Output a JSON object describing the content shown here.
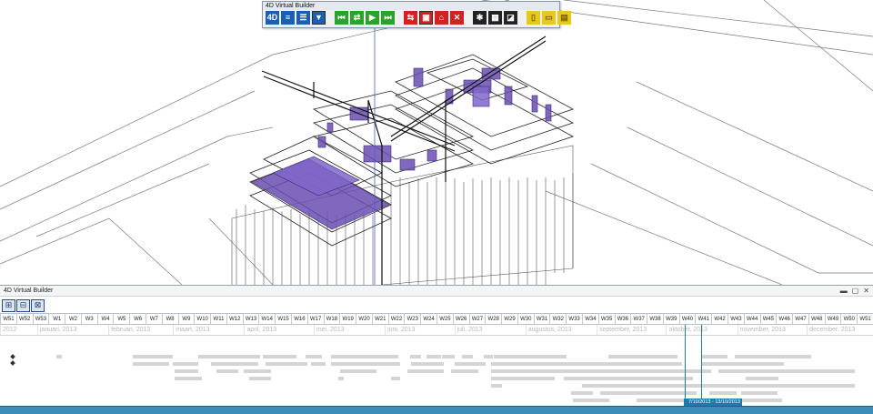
{
  "floating_toolbar": {
    "title": "4D Virtual Builder",
    "buttons": [
      {
        "name": "4d-mode-icon",
        "glyph": "4D",
        "color": "#1a5fb4"
      },
      {
        "name": "gantt-view-icon",
        "glyph": "≡",
        "color": "#1a5fb4"
      },
      {
        "name": "list-view-icon",
        "glyph": "☰",
        "color": "#1a5fb4"
      },
      {
        "name": "filter-icon",
        "glyph": "▼",
        "color": "#1a5fb4"
      },
      {
        "name": "skip-to-start-icon",
        "glyph": "⏮",
        "color": "#29a329"
      },
      {
        "name": "loop-icon",
        "glyph": "⇄",
        "color": "#29a329"
      },
      {
        "name": "play-icon",
        "glyph": "▶",
        "color": "#29a329"
      },
      {
        "name": "skip-to-end-icon",
        "glyph": "⏭",
        "color": "#29a329"
      },
      {
        "name": "task-link-icon",
        "glyph": "⇆",
        "color": "#d42020"
      },
      {
        "name": "select-elements-icon",
        "glyph": "▣",
        "color": "#d42020"
      },
      {
        "name": "home-view-icon",
        "glyph": "⌂",
        "color": "#d42020"
      },
      {
        "name": "remove-link-icon",
        "glyph": "✕",
        "color": "#d42020"
      },
      {
        "name": "settings-icon",
        "glyph": "✱",
        "color": "#222222"
      },
      {
        "name": "calendar-icon",
        "glyph": "▦",
        "color": "#222222"
      },
      {
        "name": "camera-icon",
        "glyph": "◪",
        "color": "#222222"
      },
      {
        "name": "new-file-icon",
        "glyph": "▯",
        "color": "#e8c81a"
      },
      {
        "name": "open-file-icon",
        "glyph": "▭",
        "color": "#e8c81a"
      },
      {
        "name": "save-file-icon",
        "glyph": "▤",
        "color": "#e8c81a"
      }
    ]
  },
  "timeline": {
    "title": "4D Virtual Builder",
    "window_buttons": {
      "minimize": "▬",
      "restore": "▢",
      "close": "✕"
    },
    "tools": [
      {
        "name": "zoom-fit-icon",
        "glyph": "⊞"
      },
      {
        "name": "zoom-in-icon",
        "glyph": "⊟"
      },
      {
        "name": "zoom-out-icon",
        "glyph": "⊠"
      }
    ],
    "weeks": [
      "W51",
      "W52",
      "W53",
      "W1",
      "W2",
      "W3",
      "W4",
      "W5",
      "W6",
      "W7",
      "W8",
      "W9",
      "W10",
      "W11",
      "W12",
      "W13",
      "W14",
      "W15",
      "W16",
      "W17",
      "W18",
      "W19",
      "W20",
      "W21",
      "W22",
      "W23",
      "W24",
      "W25",
      "W26",
      "W27",
      "W28",
      "W29",
      "W30",
      "W31",
      "W32",
      "W33",
      "W34",
      "W35",
      "W36",
      "W37",
      "W38",
      "W39",
      "W40",
      "W41",
      "W42",
      "W43",
      "W44",
      "W45",
      "W46",
      "W47",
      "W48",
      "W49",
      "W50",
      "W51"
    ],
    "months": [
      {
        "label": "2012",
        "span": 2.3
      },
      {
        "label": "januari, 2013",
        "span": 4.4
      },
      {
        "label": "februari, 2013",
        "span": 4
      },
      {
        "label": "maart, 2013",
        "span": 4.4
      },
      {
        "label": "april, 2013",
        "span": 4.3
      },
      {
        "label": "mei, 2013",
        "span": 4.4
      },
      {
        "label": "juni, 2013",
        "span": 4.3
      },
      {
        "label": "juli, 2013",
        "span": 4.4
      },
      {
        "label": "augustus, 2013",
        "span": 4.4
      },
      {
        "label": "september, 2013",
        "span": 4.3
      },
      {
        "label": "oktober, 2013",
        "span": 4.4
      },
      {
        "label": "november, 2013",
        "span": 4.3
      },
      {
        "label": "december, 2013",
        "span": 4.1
      }
    ],
    "current_range": "7/10/2013 - 13/10/2013",
    "accent_color": "#1e7aa8"
  }
}
